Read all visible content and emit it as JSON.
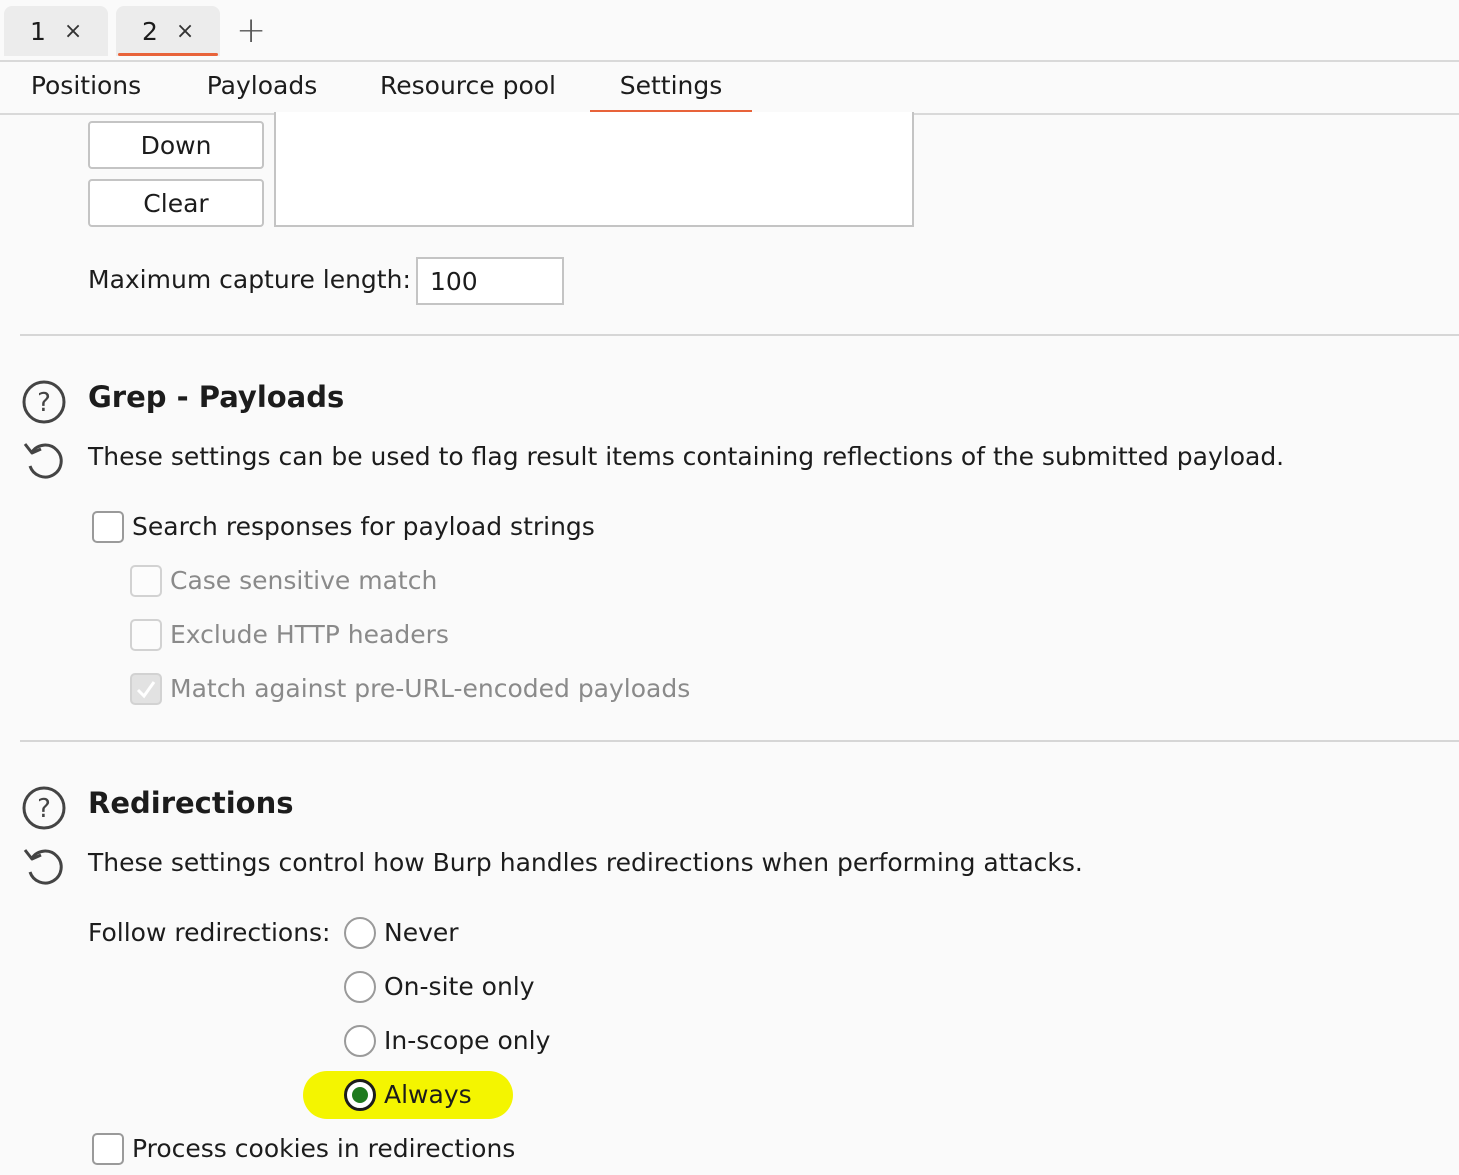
{
  "tabs": [
    {
      "label": "1",
      "close": "×"
    },
    {
      "label": "2",
      "close": "×"
    }
  ],
  "new_tab": "+",
  "subtabs": [
    "Positions",
    "Payloads",
    "Resource pool",
    "Settings"
  ],
  "buttons": {
    "down": "Down",
    "clear": "Clear"
  },
  "max_capture": {
    "label": "Maximum capture length:",
    "value": "100"
  },
  "grep_payloads": {
    "title": "Grep - Payloads",
    "description": "These settings can be used to flag result items containing reflections of the submitted payload.",
    "options": [
      {
        "label": "Search responses for payload strings"
      },
      {
        "label": "Case sensitive match"
      },
      {
        "label": "Exclude HTTP headers"
      },
      {
        "label": "Match against pre-URL-encoded payloads"
      }
    ]
  },
  "redirections": {
    "title": "Redirections",
    "description": "These settings control how Burp handles redirections when performing attacks.",
    "follow_label": "Follow redirections:",
    "radio_options": [
      "Never",
      "On-site only",
      "In-scope only",
      "Always"
    ],
    "selected": "Always",
    "process_cookies": "Process cookies in redirections"
  },
  "colors": {
    "accent": "#e8633a",
    "highlight": "#f4f500",
    "radio_fill": "#1e7a1e"
  }
}
